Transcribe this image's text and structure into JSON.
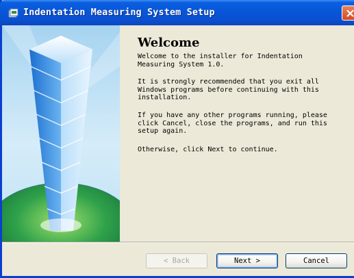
{
  "window": {
    "title": "Indentation Measuring System Setup"
  },
  "welcome": {
    "heading": "Welcome",
    "paragraphs": [
      "Welcome to the installer for Indentation\nMeasuring System 1.0.",
      "It is strongly recommended that you exit all\nWindows programs before continuing with this\ninstallation.",
      "If you have any other programs running, please\nclick Cancel, close the programs, and run this\nsetup again.",
      "Otherwise, click Next to continue."
    ]
  },
  "buttons": {
    "back": "< Back",
    "next": "Next >",
    "cancel": "Cancel"
  },
  "icons": {
    "title": "installer-icon",
    "close": "close-icon"
  },
  "colors": {
    "titlebar": "#0856d8",
    "close": "#d34a24",
    "face": "#ece9d8"
  }
}
